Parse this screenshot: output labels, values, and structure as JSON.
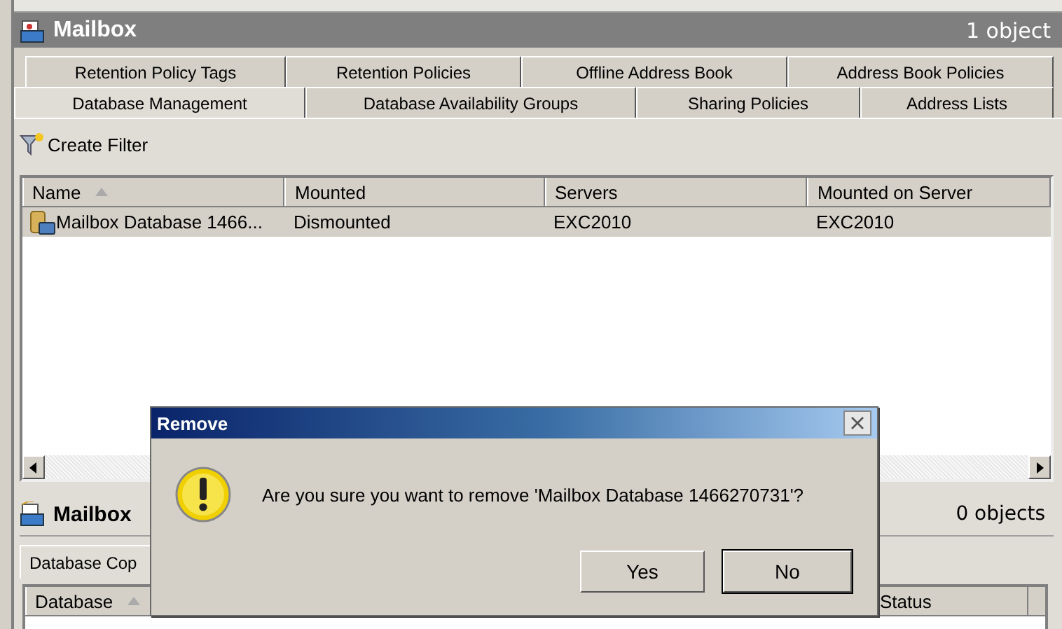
{
  "header": {
    "title": "Mailbox",
    "count": "1 object"
  },
  "tab_rows": [
    [
      {
        "label": "Retention Policy Tags",
        "selected": false
      },
      {
        "label": "Retention Policies",
        "selected": false
      },
      {
        "label": "Offline Address Book",
        "selected": false
      },
      {
        "label": "Address Book Policies",
        "selected": false
      }
    ],
    [
      {
        "label": "Database Management",
        "selected": true
      },
      {
        "label": "Database Availability Groups",
        "selected": false
      },
      {
        "label": "Sharing Policies",
        "selected": false
      },
      {
        "label": "Address Lists",
        "selected": false
      }
    ]
  ],
  "toolbar": {
    "create_filter": "Create Filter"
  },
  "table": {
    "columns": [
      {
        "label": "Name",
        "sorted": true
      },
      {
        "label": "Mounted",
        "sorted": false
      },
      {
        "label": "Servers",
        "sorted": false
      },
      {
        "label": "Mounted on Server",
        "sorted": false
      }
    ],
    "rows": [
      {
        "cells": [
          "Mailbox Database 1466...",
          "Dismounted",
          "EXC2010",
          "EXC2010"
        ],
        "selected": true
      }
    ]
  },
  "lower_pane": {
    "title": "Mailbox",
    "count": "0 objects",
    "tab": "Database Cop",
    "columns": [
      {
        "label": "Database",
        "sorted": true
      },
      {
        "label": "Status",
        "sorted": false
      }
    ]
  },
  "dialog": {
    "title": "Remove",
    "message": "Are you sure you want to remove 'Mailbox Database 1466270731'?",
    "buttons": [
      {
        "label": "Yes",
        "default": false
      },
      {
        "label": "No",
        "default": true
      }
    ]
  }
}
